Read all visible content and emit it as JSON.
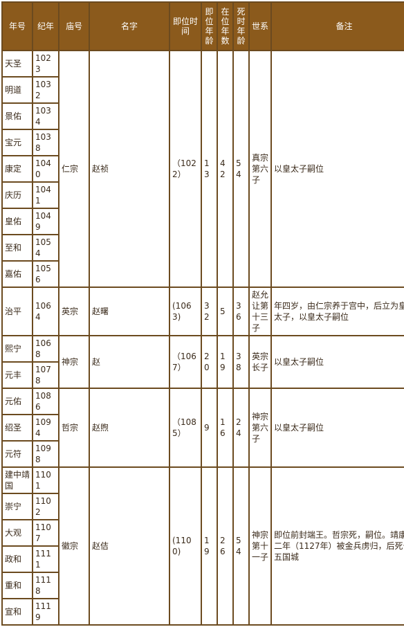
{
  "headers": {
    "era": "年号",
    "year": "纪年",
    "temple": "庙号",
    "name": "名字",
    "accession_time": "即位时间",
    "accession_age": "即位年龄",
    "reign_years": "在位年数",
    "death_age": "死时年龄",
    "lineage": "世系",
    "notes": "备注"
  },
  "emperors": [
    {
      "temple": "仁宗",
      "name": "赵祯",
      "accession_time": "（1022）",
      "accession_age": "13",
      "reign_years": "42",
      "death_age": "54",
      "lineage": "真宗第六子",
      "notes": "以皇太子嗣位",
      "eras": [
        {
          "era": "天圣",
          "year": "1023"
        },
        {
          "era": "明道",
          "year": "1032"
        },
        {
          "era": "景佑",
          "year": "1034"
        },
        {
          "era": "宝元",
          "year": "1038"
        },
        {
          "era": "康定",
          "year": "1040"
        },
        {
          "era": "庆历",
          "year": "1041"
        },
        {
          "era": "皇佑",
          "year": "1049"
        },
        {
          "era": "至和",
          "year": "1054"
        },
        {
          "era": "嘉佑",
          "year": "1056"
        }
      ]
    },
    {
      "temple": "英宗",
      "name": "赵曙",
      "accession_time": "(1063)",
      "accession_age": "32",
      "reign_years": "5",
      "death_age": "36",
      "lineage": "赵允让第十三子",
      "notes": "年四岁，由仁宗养于宫中，后立为皇太子，以皇太子嗣位",
      "eras": [
        {
          "era": "治平",
          "year": "1064"
        }
      ]
    },
    {
      "temple": "神宗",
      "name": "赵",
      "accession_time": "（1067）",
      "accession_age": "20",
      "reign_years": "19",
      "death_age": "38",
      "lineage": "英宗长子",
      "notes": "以皇太子嗣位",
      "eras": [
        {
          "era": "熙宁",
          "year": "1068"
        },
        {
          "era": "元丰",
          "year": "1078"
        }
      ]
    },
    {
      "temple": "哲宗",
      "name": "赵煦",
      "accession_time": "（1085）",
      "accession_age": "9",
      "reign_years": "16",
      "death_age": "24",
      "lineage": "神宗第六子",
      "notes": "以皇太子嗣位",
      "eras": [
        {
          "era": "元佑",
          "year": "1086"
        },
        {
          "era": "绍圣",
          "year": "1094"
        },
        {
          "era": "元符",
          "year": "1098"
        }
      ]
    },
    {
      "temple": "徽宗",
      "name": "赵佶",
      "accession_time": "(1100)",
      "accession_age": "19",
      "reign_years": "26",
      "death_age": "54",
      "lineage": "神宗第十一子",
      "notes": "即位前封端王。哲宗死，嗣位。靖康二年（1127年）被金兵虏归，后死于五国城",
      "eras": [
        {
          "era": "建中靖国",
          "year": "1101"
        },
        {
          "era": "崇宁",
          "year": "1102"
        },
        {
          "era": "大观",
          "year": "1107"
        },
        {
          "era": "政和",
          "year": "1111"
        },
        {
          "era": "重和",
          "year": "1118"
        },
        {
          "era": "宣和",
          "year": "1119"
        }
      ]
    }
  ]
}
